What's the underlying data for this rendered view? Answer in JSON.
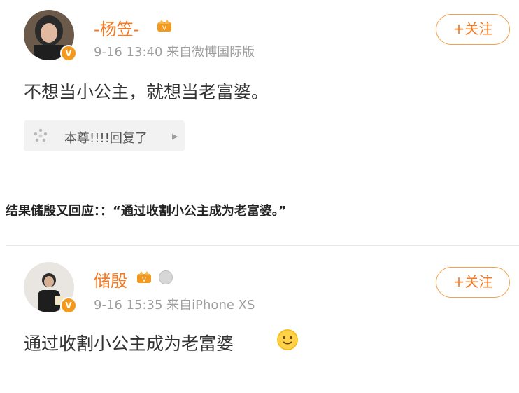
{
  "post1": {
    "username": "-杨笠-",
    "meta": "9-16 13:40  来自微博国际版",
    "follow_label": "+关注",
    "content": "不想当小公主，就想当老富婆。",
    "reply_label": "本尊!!!!回复了",
    "icons": {
      "badge": "verified-badge",
      "crown": "crown-icon",
      "reply": "sparkle-icon"
    }
  },
  "caption": "结果储殷又回应：：“通过收割小公主成为老富婆。”",
  "post2": {
    "username": "储殷",
    "meta": "9-16 15:35  来自iPhone XS",
    "follow_label": "+关注",
    "content": "通过收割小公主成为老富婆",
    "icons": {
      "badge": "verified-badge",
      "crown": "crown-icon",
      "medal": "medal-icon",
      "emoji": "smiley-emoji"
    }
  },
  "colors": {
    "accent": "#f07a26",
    "follow_border": "#f2a24d",
    "meta_gray": "#9e9e9e"
  }
}
